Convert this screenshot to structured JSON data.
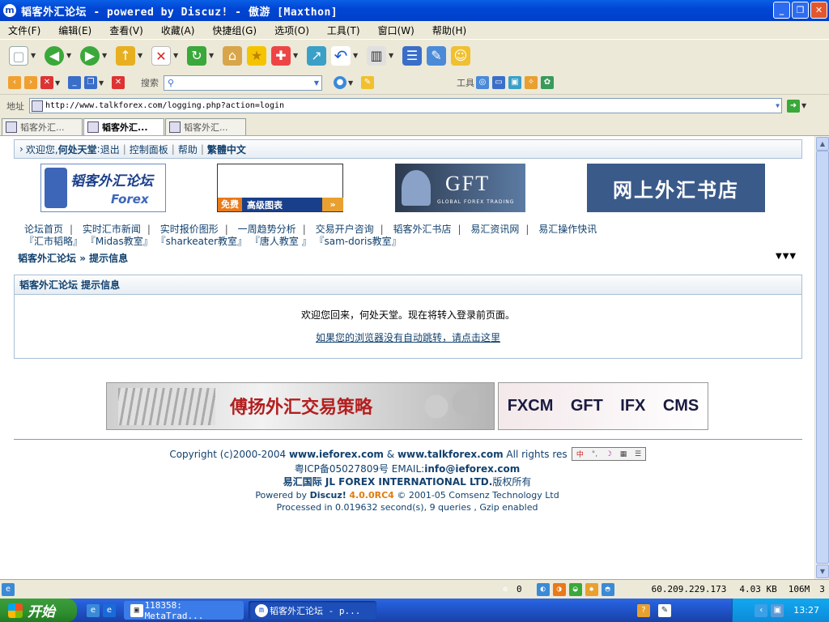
{
  "window": {
    "title": "韬客外汇论坛 - powered by Discuz! - 傲游 [Maxthon]"
  },
  "menu": [
    "文件(F)",
    "编辑(E)",
    "查看(V)",
    "收藏(A)",
    "快捷组(G)",
    "选项(O)",
    "工具(T)",
    "窗口(W)",
    "帮助(H)"
  ],
  "toolbar2": {
    "search_label": "搜索",
    "tools_label": "工具"
  },
  "address": {
    "label": "地址",
    "url": "http://www.talkforex.com/logging.php?action=login"
  },
  "tabs": [
    {
      "label": "韬客外汇..."
    },
    {
      "label": "韬客外汇..."
    },
    {
      "label": "韬客外汇..."
    }
  ],
  "page": {
    "welcome": {
      "prefix": "欢迎您, ",
      "user": "何处天堂",
      "colon": ": ",
      "links": [
        "退出",
        "控制面板",
        "帮助"
      ],
      "lang": "繁體中文"
    },
    "banners": {
      "logo_text": "韬客外汇论坛",
      "logo_sub": "Forex",
      "chart_ad": {
        "free": "免费",
        "label": "高级图表"
      },
      "gft": {
        "name": "GFT",
        "sub": "GLOBAL FOREX TRADING"
      },
      "bookstore": "网上外汇书店"
    },
    "nav_row1": [
      "论坛首页",
      "实时汇市新闻",
      "实时报价图形",
      "一周趋势分析",
      "交易开户咨询",
      "韬客外汇书店",
      "易汇资讯网",
      "易汇操作快讯"
    ],
    "nav_row2": [
      "『汇市韬略』",
      "『Midas教室』",
      "『sharkeater教室』",
      "『唐人教室 』",
      "『sam-doris教室』"
    ],
    "breadcrumb": {
      "forum": "韬客外汇论坛",
      "sep": " » ",
      "page": "提示信息"
    },
    "message": {
      "header": "韬客外汇论坛 提示信息",
      "line1": "欢迎您回来，何处天堂。现在将转入登录前页面。",
      "line2": "如果您的浏览器没有自动跳转，请点击这里"
    },
    "ads": {
      "strategy": "傅扬外汇交易策略",
      "brokers": [
        "FXCM",
        "GFT",
        "IFX",
        "CMS"
      ]
    },
    "footer": {
      "copyright_prefix": "Copyright (c)2000-2004 ",
      "site1": "www.ieforex.com",
      "amp": " & ",
      "site2": "www.talkforex.com",
      "rights": "  All rights res",
      "icp": "粤ICP备05027809号  EMAIL:",
      "email": "info@ieforex.com",
      "company": "易汇国际 JL FOREX INTERNATIONAL LTD.",
      "company_suffix": "版权所有",
      "powered_prefix": "Powered by ",
      "discuz": "Discuz!",
      "version": "4.0.0RC4",
      "comsenz": "  © 2001-05 Comsenz Technology Ltd",
      "processed": "Processed in 0.019632 second(s), 9 queries , Gzip enabled"
    }
  },
  "status": {
    "count": "0",
    "ip": "60.209.229.173",
    "size": "4.03 KB",
    "mem": "106M",
    "tabs": "3"
  },
  "taskbar": {
    "start": "开始",
    "tasks": [
      "118358: MetaTrad...",
      "韬客外汇论坛 - p..."
    ],
    "clock": "13:27"
  },
  "colors": {
    "accent": "#12416e",
    "title_bar": "#0046d5",
    "version": "#e07b10"
  }
}
